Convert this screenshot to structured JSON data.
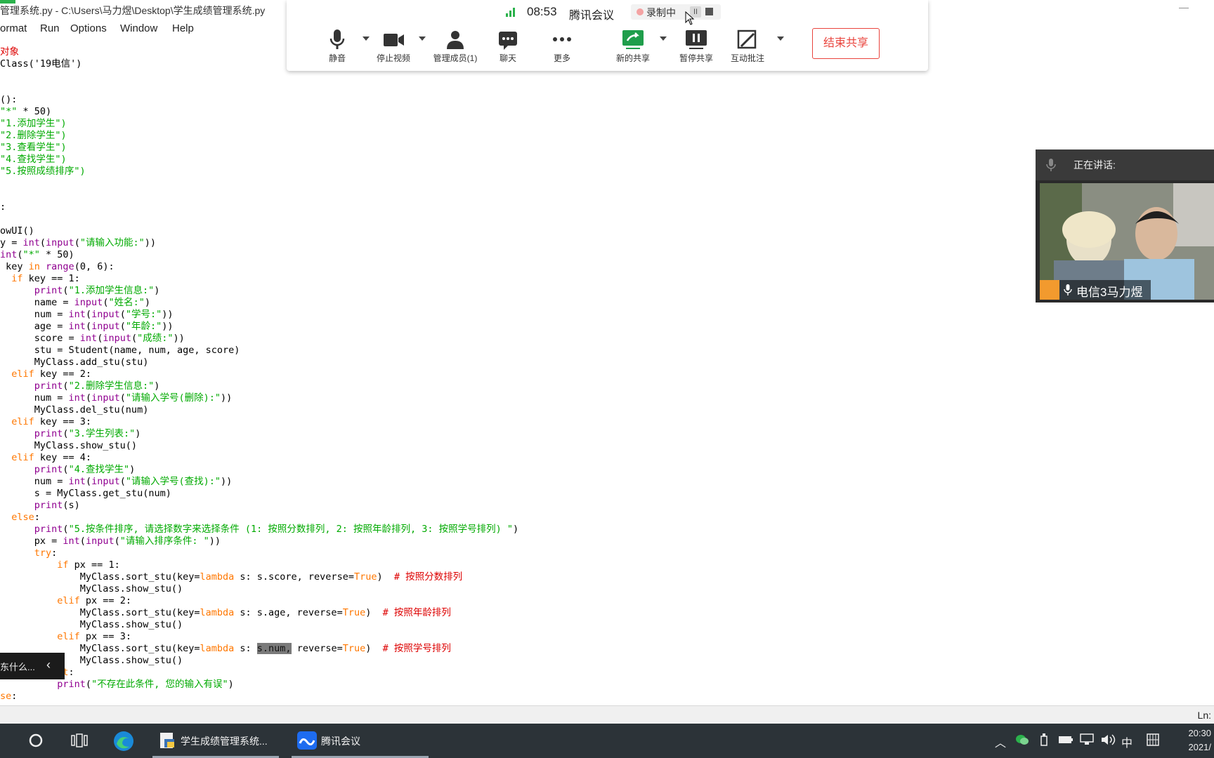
{
  "window": {
    "title": "管理系统.py - C:\\Users\\马力煜\\Desktop\\学生成绩管理系统.py",
    "menu": [
      "ormat",
      "Run",
      "Options",
      "Window",
      "Help"
    ]
  },
  "code_lines": [
    [
      {
        "t": "对象",
        "c": "cm"
      }
    ],
    [
      {
        "t": "Class('19电信')",
        "c": ""
      }
    ],
    [
      {
        "t": "",
        "c": ""
      }
    ],
    [
      {
        "t": "",
        "c": ""
      }
    ],
    [
      {
        "t": "():",
        "c": ""
      }
    ],
    [
      {
        "t": "\"*\"",
        "c": "st"
      },
      {
        "t": " * 50)",
        "c": ""
      }
    ],
    [
      {
        "t": "\"1.添加学生\")",
        "c": "st"
      }
    ],
    [
      {
        "t": "\"2.删除学生\")",
        "c": "st"
      }
    ],
    [
      {
        "t": "\"3.查看学生\")",
        "c": "st"
      }
    ],
    [
      {
        "t": "\"4.查找学生\")",
        "c": "st"
      }
    ],
    [
      {
        "t": "\"5.按照成绩排序\")",
        "c": "st"
      }
    ],
    [
      {
        "t": "",
        "c": ""
      }
    ],
    [
      {
        "t": "",
        "c": ""
      }
    ],
    [
      {
        "t": ":",
        "c": ""
      }
    ],
    [
      {
        "t": "",
        "c": ""
      }
    ],
    [
      {
        "t": "owUI()",
        "c": ""
      }
    ],
    [
      {
        "t": "y = ",
        "c": ""
      },
      {
        "t": "int",
        "c": "bi"
      },
      {
        "t": "(",
        "c": ""
      },
      {
        "t": "input",
        "c": "bi"
      },
      {
        "t": "(",
        "c": ""
      },
      {
        "t": "\"请输入功能:\"",
        "c": "st"
      },
      {
        "t": "))",
        "c": ""
      }
    ],
    [
      {
        "t": "int",
        "c": "bi"
      },
      {
        "t": "(",
        "c": ""
      },
      {
        "t": "\"*\"",
        "c": "st"
      },
      {
        "t": " * 50)",
        "c": ""
      }
    ],
    [
      {
        "t": " key ",
        "c": ""
      },
      {
        "t": "in",
        "c": "kw"
      },
      {
        "t": " ",
        "c": ""
      },
      {
        "t": "range",
        "c": "bi"
      },
      {
        "t": "(0, 6):",
        "c": ""
      }
    ],
    [
      {
        "t": "  ",
        "c": ""
      },
      {
        "t": "if",
        "c": "kw"
      },
      {
        "t": " key == 1:",
        "c": ""
      }
    ],
    [
      {
        "t": "      ",
        "c": ""
      },
      {
        "t": "print",
        "c": "bi"
      },
      {
        "t": "(",
        "c": ""
      },
      {
        "t": "\"1.添加学生信息:\"",
        "c": "st"
      },
      {
        "t": ")",
        "c": ""
      }
    ],
    [
      {
        "t": "      name = ",
        "c": ""
      },
      {
        "t": "input",
        "c": "bi"
      },
      {
        "t": "(",
        "c": ""
      },
      {
        "t": "\"姓名:\"",
        "c": "st"
      },
      {
        "t": ")",
        "c": ""
      }
    ],
    [
      {
        "t": "      num = ",
        "c": ""
      },
      {
        "t": "int",
        "c": "bi"
      },
      {
        "t": "(",
        "c": ""
      },
      {
        "t": "input",
        "c": "bi"
      },
      {
        "t": "(",
        "c": ""
      },
      {
        "t": "\"学号:\"",
        "c": "st"
      },
      {
        "t": "))",
        "c": ""
      }
    ],
    [
      {
        "t": "      age = ",
        "c": ""
      },
      {
        "t": "int",
        "c": "bi"
      },
      {
        "t": "(",
        "c": ""
      },
      {
        "t": "input",
        "c": "bi"
      },
      {
        "t": "(",
        "c": ""
      },
      {
        "t": "\"年龄:\"",
        "c": "st"
      },
      {
        "t": "))",
        "c": ""
      }
    ],
    [
      {
        "t": "      score = ",
        "c": ""
      },
      {
        "t": "int",
        "c": "bi"
      },
      {
        "t": "(",
        "c": ""
      },
      {
        "t": "input",
        "c": "bi"
      },
      {
        "t": "(",
        "c": ""
      },
      {
        "t": "\"成绩:\"",
        "c": "st"
      },
      {
        "t": "))",
        "c": ""
      }
    ],
    [
      {
        "t": "      stu = Student(name, num, age, score)",
        "c": ""
      }
    ],
    [
      {
        "t": "      MyClass.add_stu(stu)",
        "c": ""
      }
    ],
    [
      {
        "t": "  ",
        "c": ""
      },
      {
        "t": "elif",
        "c": "kw"
      },
      {
        "t": " key == 2:",
        "c": ""
      }
    ],
    [
      {
        "t": "      ",
        "c": ""
      },
      {
        "t": "print",
        "c": "bi"
      },
      {
        "t": "(",
        "c": ""
      },
      {
        "t": "\"2.删除学生信息:\"",
        "c": "st"
      },
      {
        "t": ")",
        "c": ""
      }
    ],
    [
      {
        "t": "      num = ",
        "c": ""
      },
      {
        "t": "int",
        "c": "bi"
      },
      {
        "t": "(",
        "c": ""
      },
      {
        "t": "input",
        "c": "bi"
      },
      {
        "t": "(",
        "c": ""
      },
      {
        "t": "\"请输入学号(删除):\"",
        "c": "st"
      },
      {
        "t": "))",
        "c": ""
      }
    ],
    [
      {
        "t": "      MyClass.del_stu(num)",
        "c": ""
      }
    ],
    [
      {
        "t": "  ",
        "c": ""
      },
      {
        "t": "elif",
        "c": "kw"
      },
      {
        "t": " key == 3:",
        "c": ""
      }
    ],
    [
      {
        "t": "      ",
        "c": ""
      },
      {
        "t": "print",
        "c": "bi"
      },
      {
        "t": "(",
        "c": ""
      },
      {
        "t": "\"3.学生列表:\"",
        "c": "st"
      },
      {
        "t": ")",
        "c": ""
      }
    ],
    [
      {
        "t": "      MyClass.show_stu()",
        "c": ""
      }
    ],
    [
      {
        "t": "  ",
        "c": ""
      },
      {
        "t": "elif",
        "c": "kw"
      },
      {
        "t": " key == 4:",
        "c": ""
      }
    ],
    [
      {
        "t": "      ",
        "c": ""
      },
      {
        "t": "print",
        "c": "bi"
      },
      {
        "t": "(",
        "c": ""
      },
      {
        "t": "\"4.查找学生\"",
        "c": "st"
      },
      {
        "t": ")",
        "c": ""
      }
    ],
    [
      {
        "t": "      num = ",
        "c": ""
      },
      {
        "t": "int",
        "c": "bi"
      },
      {
        "t": "(",
        "c": ""
      },
      {
        "t": "input",
        "c": "bi"
      },
      {
        "t": "(",
        "c": ""
      },
      {
        "t": "\"请输入学号(查找):\"",
        "c": "st"
      },
      {
        "t": "))",
        "c": ""
      }
    ],
    [
      {
        "t": "      s = MyClass.get_stu(num)",
        "c": ""
      }
    ],
    [
      {
        "t": "      ",
        "c": ""
      },
      {
        "t": "print",
        "c": "bi"
      },
      {
        "t": "(s)",
        "c": ""
      }
    ],
    [
      {
        "t": "  ",
        "c": ""
      },
      {
        "t": "else",
        "c": "kw"
      },
      {
        "t": ":",
        "c": ""
      }
    ],
    [
      {
        "t": "      ",
        "c": ""
      },
      {
        "t": "print",
        "c": "bi"
      },
      {
        "t": "(",
        "c": ""
      },
      {
        "t": "\"5.按条件排序, 请选择数字来选择条件 (1: 按照分数排列, 2: 按照年龄排列, 3: 按照学号排列) \"",
        "c": "st"
      },
      {
        "t": ")",
        "c": ""
      }
    ],
    [
      {
        "t": "      px = ",
        "c": ""
      },
      {
        "t": "int",
        "c": "bi"
      },
      {
        "t": "(",
        "c": ""
      },
      {
        "t": "input",
        "c": "bi"
      },
      {
        "t": "(",
        "c": ""
      },
      {
        "t": "\"请输入排序条件: \"",
        "c": "st"
      },
      {
        "t": "))",
        "c": ""
      }
    ],
    [
      {
        "t": "      ",
        "c": ""
      },
      {
        "t": "try",
        "c": "kw"
      },
      {
        "t": ":",
        "c": ""
      }
    ],
    [
      {
        "t": "          ",
        "c": ""
      },
      {
        "t": "if",
        "c": "kw"
      },
      {
        "t": " px == 1:",
        "c": ""
      }
    ],
    [
      {
        "t": "              MyClass.sort_stu(key=",
        "c": ""
      },
      {
        "t": "lambda",
        "c": "kw"
      },
      {
        "t": " s: s.score, reverse=",
        "c": ""
      },
      {
        "t": "True",
        "c": "kw"
      },
      {
        "t": ")  ",
        "c": ""
      },
      {
        "t": "# 按照分数排列",
        "c": "cm"
      }
    ],
    [
      {
        "t": "              MyClass.show_stu()",
        "c": ""
      }
    ],
    [
      {
        "t": "          ",
        "c": ""
      },
      {
        "t": "elif",
        "c": "kw"
      },
      {
        "t": " px == 2:",
        "c": ""
      }
    ],
    [
      {
        "t": "              MyClass.sort_stu(key=",
        "c": ""
      },
      {
        "t": "lambda",
        "c": "kw"
      },
      {
        "t": " s: s.age, reverse=",
        "c": ""
      },
      {
        "t": "True",
        "c": "kw"
      },
      {
        "t": ")  ",
        "c": ""
      },
      {
        "t": "# 按照年龄排列",
        "c": "cm"
      }
    ],
    [
      {
        "t": "              MyClass.show_stu()",
        "c": ""
      }
    ],
    [
      {
        "t": "          ",
        "c": ""
      },
      {
        "t": "elif",
        "c": "kw"
      },
      {
        "t": " px == 3:",
        "c": ""
      }
    ],
    [
      {
        "t": "              MyClass.sort_stu(key=",
        "c": ""
      },
      {
        "t": "lambda",
        "c": "kw"
      },
      {
        "t": " s: ",
        "c": ""
      },
      {
        "t": "s.num,",
        "c": "sel"
      },
      {
        "t": " reverse=",
        "c": ""
      },
      {
        "t": "True",
        "c": "kw"
      },
      {
        "t": ")  ",
        "c": ""
      },
      {
        "t": "# 按照学号排列",
        "c": "cm"
      }
    ],
    [
      {
        "t": "              MyClass.show_stu()",
        "c": ""
      }
    ],
    [
      {
        "t": "          ",
        "c": ""
      },
      {
        "t": "pt",
        "c": "kw"
      },
      {
        "t": ":",
        "c": ""
      }
    ],
    [
      {
        "t": "          ",
        "c": ""
      },
      {
        "t": "print",
        "c": "bi"
      },
      {
        "t": "(",
        "c": ""
      },
      {
        "t": "\"不存在此条件, 您的输入有误\"",
        "c": "st"
      },
      {
        "t": ")",
        "c": ""
      }
    ],
    [
      {
        "t": "se",
        "c": "kw"
      },
      {
        "t": ":",
        "c": ""
      }
    ]
  ],
  "status": {
    "line_col": "Ln:"
  },
  "meeting": {
    "time": "08:53",
    "app_name": "腾讯会议",
    "recording": "录制中",
    "pause_glyph": "II",
    "tools": {
      "mute": "静音",
      "stop_video": "停止视频",
      "manage_members": "管理成员(1)",
      "chat": "聊天",
      "more": "更多",
      "new_share": "新的共享",
      "pause_share": "暂停共享",
      "annotate": "互动批注"
    },
    "end_share": "结束共享"
  },
  "speaker": {
    "header": "正在讲话:",
    "name": "电信3马力煜"
  },
  "mini_panel": {
    "text": "东什么...",
    "collapse": "‹"
  },
  "taskbar": {
    "task1": "学生成绩管理系统...",
    "task2": "腾讯会议",
    "ime": "中",
    "time": "20:30",
    "date": "2021/"
  },
  "colors": {
    "accent_green": "#2bb24c",
    "end_share_red": "#e9443d",
    "keyword": "#ff7700",
    "string": "#00aa00",
    "comment": "#dd0000",
    "builtin": "#900090"
  }
}
